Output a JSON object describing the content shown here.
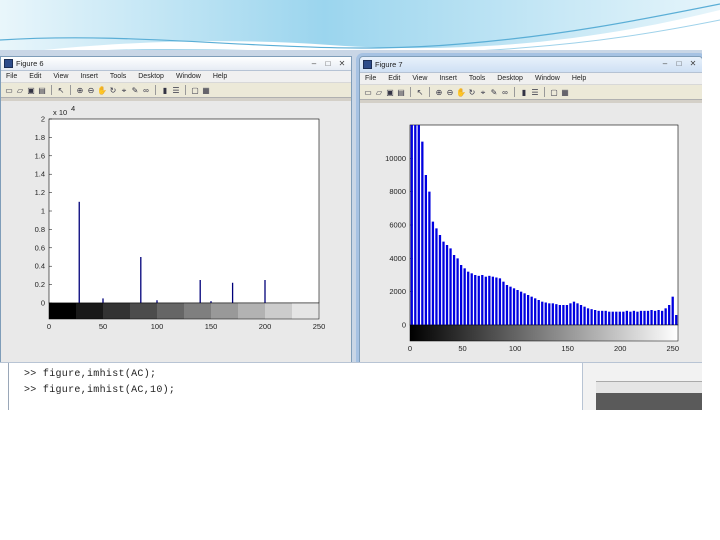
{
  "figure_left": {
    "title": "Figure 6",
    "menu": [
      "File",
      "Edit",
      "View",
      "Insert",
      "Tools",
      "Desktop",
      "Window",
      "Help"
    ],
    "toolbar_icons": [
      "new-file-icon",
      "open-folder-icon",
      "save-icon",
      "print-icon",
      "pointer-icon",
      "zoom-in-icon",
      "zoom-out-icon",
      "pan-icon",
      "rotate-icon",
      "data-cursor-icon",
      "brush-icon",
      "link-icon",
      "colorbar-icon",
      "legend-icon",
      "hide-plot-tools-icon",
      "show-plot-tools-icon"
    ],
    "window_buttons": {
      "minimize": "–",
      "maximize": "□",
      "close": "✕"
    },
    "chart_data": {
      "type": "bar",
      "exponent_label": "x 10",
      "exponent_power": "4",
      "x": [
        28,
        50,
        85,
        100,
        140,
        150,
        170,
        200
      ],
      "values": [
        1.1,
        0.05,
        0.5,
        0.03,
        0.25,
        0.02,
        0.22,
        0.25
      ],
      "xlim": [
        0,
        250
      ],
      "ylim": [
        0,
        2
      ],
      "xticks": [
        "0",
        "50",
        "100",
        "150",
        "200",
        "250"
      ],
      "yticks": [
        "0",
        "0.2",
        "0.4",
        "0.6",
        "0.8",
        "1",
        "1.2",
        "1.4",
        "1.6",
        "1.8",
        "2"
      ],
      "bar_color": "#00007a",
      "gray_levels": [
        0,
        25,
        51,
        76,
        102,
        127,
        153,
        178,
        204,
        229
      ]
    }
  },
  "figure_right": {
    "title": "Figure 7",
    "menu": [
      "File",
      "Edit",
      "View",
      "Insert",
      "Tools",
      "Desktop",
      "Window",
      "Help"
    ],
    "toolbar_icons": [
      "new-file-icon",
      "open-folder-icon",
      "save-icon",
      "print-icon",
      "pointer-icon",
      "zoom-in-icon",
      "zoom-out-icon",
      "pan-icon",
      "rotate-icon",
      "data-cursor-icon",
      "brush-icon",
      "link-icon",
      "colorbar-icon",
      "legend-icon",
      "hide-plot-tools-icon",
      "show-plot-tools-icon"
    ],
    "window_buttons": {
      "minimize": "–",
      "maximize": "□",
      "close": "✕"
    },
    "chart_data": {
      "type": "bar",
      "xlim": [
        0,
        255
      ],
      "ylim": [
        0,
        12000
      ],
      "xticks": [
        "0",
        "50",
        "100",
        "150",
        "200",
        "250"
      ],
      "yticks": [
        "0",
        "2000",
        "4000",
        "6000",
        "8000",
        "10000"
      ],
      "bar_color": "#0000e0",
      "values": [
        12000,
        12000,
        12000,
        11000,
        9000,
        8000,
        6200,
        5800,
        5400,
        5000,
        4800,
        4600,
        4200,
        4000,
        3600,
        3400,
        3200,
        3100,
        3000,
        2950,
        3000,
        2900,
        2950,
        2900,
        2850,
        2800,
        2600,
        2400,
        2300,
        2200,
        2100,
        2000,
        1900,
        1800,
        1700,
        1600,
        1500,
        1400,
        1350,
        1300,
        1300,
        1250,
        1200,
        1200,
        1200,
        1300,
        1400,
        1300,
        1200,
        1100,
        1000,
        950,
        900,
        850,
        850,
        850,
        800,
        800,
        800,
        800,
        800,
        850,
        800,
        850,
        800,
        850,
        850,
        850,
        900,
        850,
        900,
        850,
        1000,
        1200,
        1700,
        600
      ]
    }
  },
  "command_window": {
    "line1": ">> figure,imhist(AC);",
    "line2": ">> figure,imhist(AC,10);"
  },
  "colors": {
    "banner": "#7fc7e6",
    "figure_frame": "#d4d0c8",
    "plot_background": "#ffffff"
  }
}
